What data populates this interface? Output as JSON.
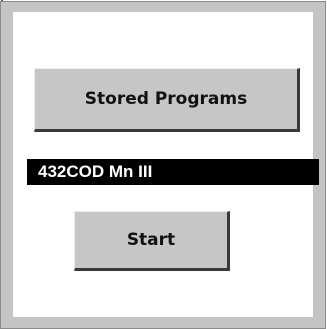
{
  "buttons": {
    "stored_programs_label": "Stored Programs",
    "start_label": "Start"
  },
  "program_display": {
    "number": "432",
    "name": "COD Mn III"
  },
  "colors": {
    "frame": "#c4c4c4",
    "panel": "#ffffff",
    "button_face": "#c6c6c6",
    "display_background": "#000000",
    "display_text": "#ffffff"
  }
}
